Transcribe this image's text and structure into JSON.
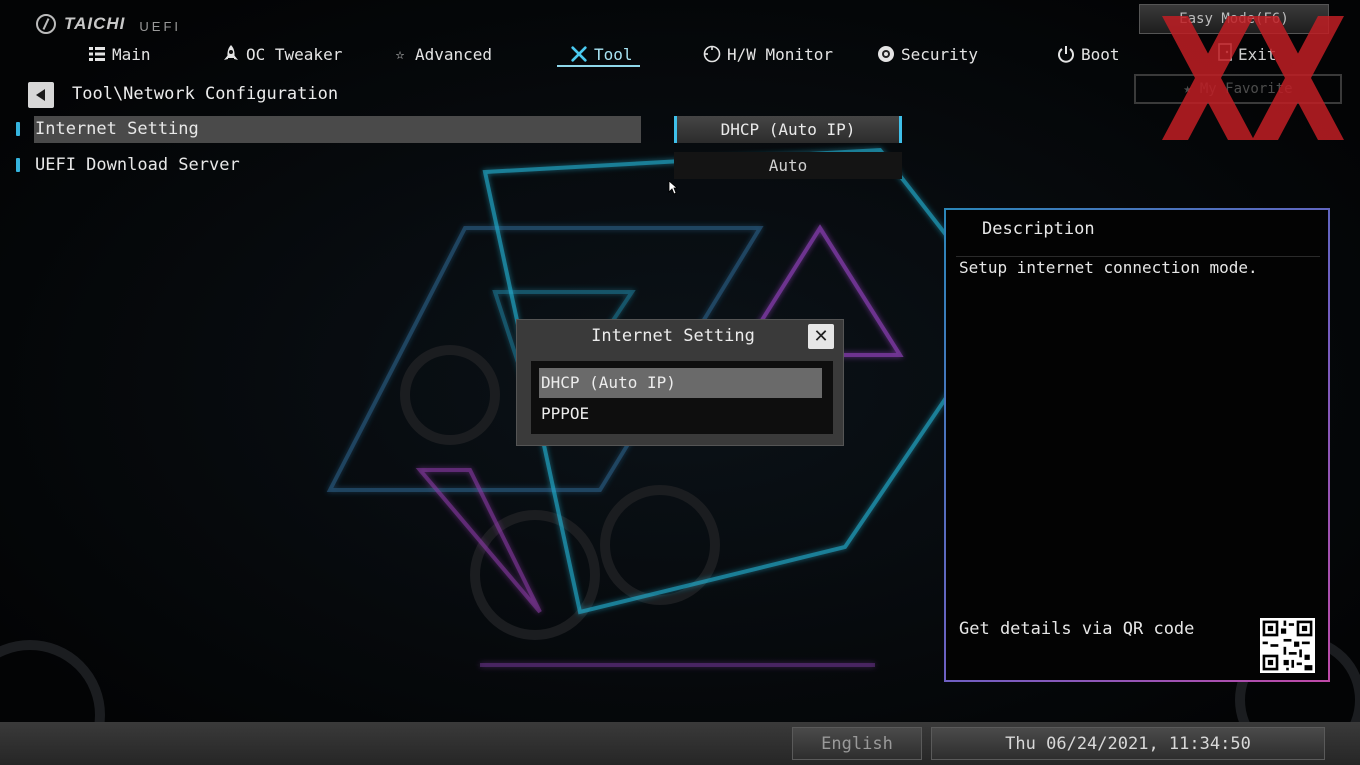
{
  "brand": {
    "name": "TAICHI",
    "sub": "UEFI"
  },
  "nav": {
    "items": [
      {
        "label": "Main",
        "icon": "list-icon"
      },
      {
        "label": "OC Tweaker",
        "icon": "rocket-icon"
      },
      {
        "label": "Advanced",
        "icon": "star-icon"
      },
      {
        "label": "Tool",
        "icon": "tools-icon",
        "active": true
      },
      {
        "label": "H/W Monitor",
        "icon": "monitor-icon"
      },
      {
        "label": "Security",
        "icon": "shield-icon"
      },
      {
        "label": "Boot",
        "icon": "power-icon"
      }
    ],
    "exit_label": "Exit",
    "easy_mode_label": "Easy Mode(F6)",
    "favorite_label": "My Favorite"
  },
  "breadcrumb": "Tool\\Network Configuration",
  "settings": [
    {
      "label": "Internet Setting",
      "value": "DHCP (Auto IP)"
    },
    {
      "label": "UEFI Download Server",
      "value": "Auto"
    }
  ],
  "description": {
    "title": "Description",
    "text": "Setup internet connection mode.",
    "qr_label": "Get details via QR code"
  },
  "popup": {
    "title": "Internet Setting",
    "options": [
      "DHCP (Auto IP)",
      "PPPOE"
    ],
    "selected": "DHCP (Auto IP)"
  },
  "footer": {
    "language": "English",
    "datetime": "Thu 06/24/2021, 11:34:50"
  },
  "colors": {
    "accent": "#3fc0ea",
    "watermark": "#c01e24"
  }
}
